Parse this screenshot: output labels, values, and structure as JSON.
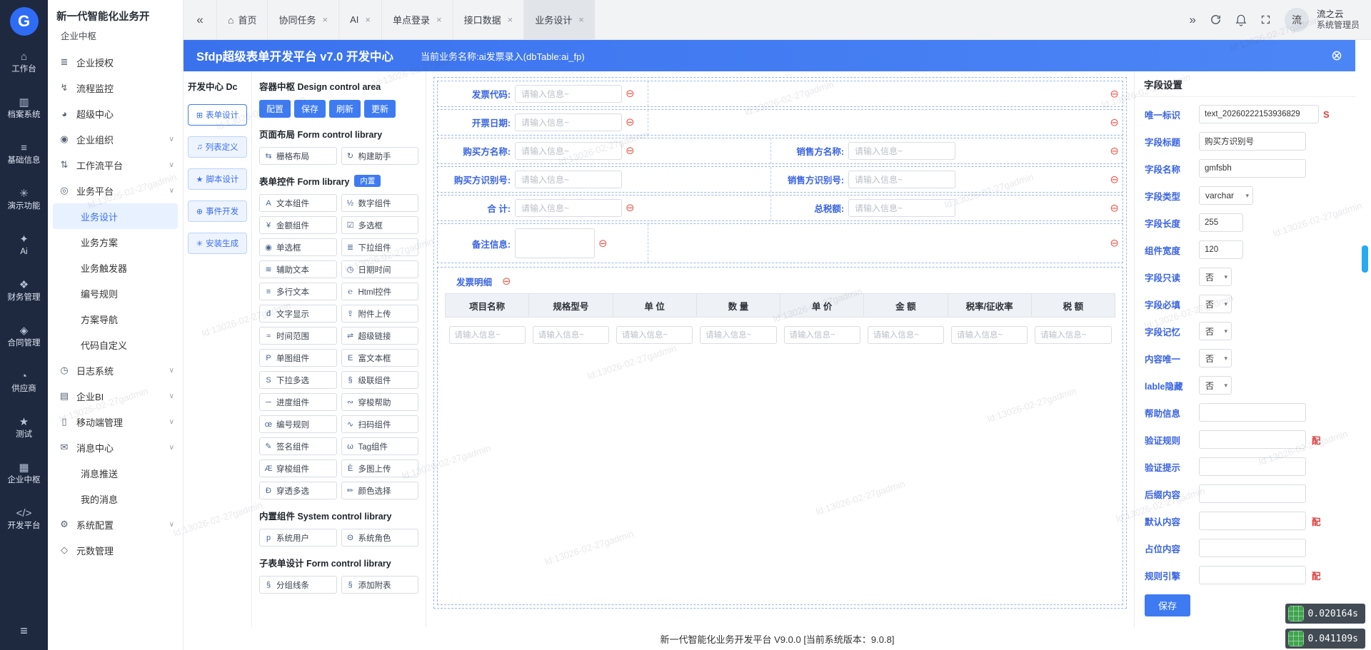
{
  "watermark_text": "ld:13026-02-27gadmin",
  "ui": {
    "chevron_down": "▾"
  },
  "rail": {
    "logo_text": "G",
    "items": [
      {
        "icon": "⌂",
        "label": "工作台"
      },
      {
        "icon": "▥",
        "label": "档案系统"
      },
      {
        "icon": "≡",
        "label": "基础信息"
      },
      {
        "icon": "✳",
        "label": "演示功能"
      },
      {
        "icon": "✦",
        "label": "Ai"
      },
      {
        "icon": "❖",
        "label": "财务管理"
      },
      {
        "icon": "◈",
        "label": "合同管理"
      },
      {
        "icon": "◔",
        "label": "供应商"
      },
      {
        "icon": "★",
        "label": "测试"
      },
      {
        "icon": "▦",
        "label": "企业中枢"
      },
      {
        "icon": "</>",
        "label": "开发平台"
      }
    ],
    "bottom_menu_icon": "≡"
  },
  "sidebar": {
    "title": "新一代智能化业务开",
    "subtitle": "企业中枢",
    "menu": [
      {
        "icon": "≣",
        "label": "企业授权"
      },
      {
        "icon": "↯",
        "label": "流程监控"
      },
      {
        "icon": "◕",
        "label": "超级中心"
      },
      {
        "icon": "◉",
        "label": "企业组织",
        "arrow": "∨"
      },
      {
        "icon": "⇅",
        "label": "工作流平台",
        "arrow": "∨"
      },
      {
        "icon": "◎",
        "label": "业务平台",
        "arrow": "∨",
        "children": [
          {
            "label": "业务设计"
          },
          {
            "label": "业务方案"
          },
          {
            "label": "业务触发器"
          },
          {
            "label": "编号规则"
          },
          {
            "label": "方案导航"
          },
          {
            "label": "代码自定义"
          }
        ]
      },
      {
        "icon": "◷",
        "label": "日志系统",
        "arrow": "∨"
      },
      {
        "icon": "▤",
        "label": "企业BI",
        "arrow": "∨"
      },
      {
        "icon": "▯",
        "label": "移动端管理",
        "arrow": "∨"
      },
      {
        "icon": "✉",
        "label": "消息中心",
        "arrow": "∨",
        "children": [
          {
            "label": "消息推送"
          },
          {
            "label": "我的消息"
          }
        ]
      },
      {
        "icon": "⚙",
        "label": "系统配置",
        "arrow": "∨"
      },
      {
        "icon": "◇",
        "label": "元数管理"
      }
    ]
  },
  "tabbar": {
    "collapse_icon": "«",
    "expand_icon": "»",
    "home_icon": "⌂",
    "close_icon": "×",
    "tabs": [
      {
        "label": "首页"
      },
      {
        "label": "协同任务"
      },
      {
        "label": "AI"
      },
      {
        "label": "单点登录"
      },
      {
        "label": "接口数据"
      },
      {
        "label": "业务设计"
      }
    ],
    "user": {
      "avatar_text": "流",
      "name": "流之云",
      "role": "系统管理员"
    }
  },
  "dev_window": {
    "title": "Sfdp超级表单开发平台 v7.0 开发中心",
    "business_label": "当前业务名称:ai发票录入(dbTable:ai_fp)",
    "close_icon": "⊗"
  },
  "dev_center": {
    "title": "开发中心 Dc",
    "tabs": [
      {
        "icon": "⊞",
        "label": "表单设计"
      },
      {
        "icon": "♫",
        "label": "列表定义"
      },
      {
        "icon": "★",
        "label": "脚本设计"
      },
      {
        "icon": "⊕",
        "label": "事件开发"
      },
      {
        "icon": "✳",
        "label": "安装生成"
      }
    ]
  },
  "control_area": {
    "title": "容器中枢 Design control area",
    "actions": [
      {
        "label": "配置"
      },
      {
        "label": "保存"
      },
      {
        "label": "刷新"
      },
      {
        "label": "更新"
      }
    ],
    "layout_section": {
      "title": "页面布局 Form control library",
      "items": [
        {
          "icon": "⇆",
          "label": "栅格布局"
        },
        {
          "icon": "↻",
          "label": "构建助手"
        }
      ]
    },
    "form_section": {
      "title": "表单控件 Form library",
      "badge": "内置",
      "items": [
        {
          "icon": "A",
          "label": "文本组件"
        },
        {
          "icon": "½",
          "label": "数字组件"
        },
        {
          "icon": "¥",
          "label": "金额组件"
        },
        {
          "icon": "☑",
          "label": "多选框"
        },
        {
          "icon": "◉",
          "label": "单选框"
        },
        {
          "icon": "≣",
          "label": "下拉组件"
        },
        {
          "icon": "≋",
          "label": "辅助文本"
        },
        {
          "icon": "◷",
          "label": "日期时间"
        },
        {
          "icon": "≡",
          "label": "多行文本"
        },
        {
          "icon": "℮",
          "label": "Html控件"
        },
        {
          "icon": "đ",
          "label": "文字显示"
        },
        {
          "icon": "⇪",
          "label": "附件上传"
        },
        {
          "icon": "≈",
          "label": "时间范围"
        },
        {
          "icon": "⇌",
          "label": "超级链接"
        },
        {
          "icon": "P",
          "label": "单图组件"
        },
        {
          "icon": "E",
          "label": "富文本框"
        },
        {
          "icon": "S",
          "label": "下拉多选"
        },
        {
          "icon": "§",
          "label": "级联组件"
        },
        {
          "icon": "─",
          "label": "进度组件"
        },
        {
          "icon": "∾",
          "label": "穿梭帮助"
        },
        {
          "icon": "œ",
          "label": "编号规则"
        },
        {
          "icon": "∿",
          "label": "扫码组件"
        },
        {
          "icon": "✎",
          "label": "签名组件"
        },
        {
          "icon": "ω",
          "label": "Tag组件"
        },
        {
          "icon": "Æ",
          "label": "穿梭组件"
        },
        {
          "icon": "È",
          "label": "多图上传"
        },
        {
          "icon": "Đ",
          "label": "穿透多选"
        },
        {
          "icon": "✏",
          "label": "颜色选择"
        }
      ]
    },
    "system_section": {
      "title": "内置组件 System control library",
      "items": [
        {
          "icon": "p",
          "label": "系统用户"
        },
        {
          "icon": "Θ",
          "label": "系统角色"
        }
      ]
    },
    "subform_section": {
      "title": "子表单设计 Form control library",
      "items": [
        {
          "icon": "§",
          "label": "分组线条"
        },
        {
          "icon": "§",
          "label": "添加附表"
        }
      ]
    }
  },
  "canvas": {
    "placeholder": "请输入信息~",
    "remove_icon": "⊖",
    "rows": [
      {
        "left": {
          "label": "发票代码:"
        }
      },
      {
        "left": {
          "label": "开票日期:"
        }
      },
      {
        "left": {
          "label": "购买方名称:"
        },
        "right": {
          "label": "销售方名称:"
        }
      },
      {
        "left": {
          "label": "购买方识别号:"
        },
        "right": {
          "label": "销售方识别号:"
        }
      },
      {
        "left": {
          "label": "合 计:"
        },
        "right": {
          "label": "总税额:"
        }
      },
      {
        "left": {
          "label": "备注信息:"
        }
      }
    ],
    "subtable": {
      "title": "发票明细",
      "columns": [
        "项目名称",
        "规格型号",
        "单 位",
        "数 量",
        "单 价",
        "金 额",
        "税率/征收率",
        "税 额"
      ]
    }
  },
  "field_settings": {
    "title": "字段设置",
    "rows": [
      {
        "label": "唯一标识",
        "value": "text_20260222153936829",
        "suffix": "S"
      },
      {
        "label": "字段标题",
        "value": "购买方识别号"
      },
      {
        "label": "字段名称",
        "value": "gmfsbh"
      },
      {
        "label": "字段类型",
        "value": "varchar"
      },
      {
        "label": "字段长度",
        "value": "255"
      },
      {
        "label": "组件宽度",
        "value": "120"
      },
      {
        "label": "字段只读",
        "value": "否"
      },
      {
        "label": "字段必填",
        "value": "否"
      },
      {
        "label": "字段记忆",
        "value": "否"
      },
      {
        "label": "内容唯一",
        "value": "否"
      },
      {
        "label": "lable隐藏",
        "value": "否"
      },
      {
        "label": "帮助信息",
        "value": ""
      },
      {
        "label": "验证规则",
        "value": "",
        "action": "配"
      },
      {
        "label": "验证提示",
        "value": ""
      },
      {
        "label": "后缀内容",
        "value": ""
      },
      {
        "label": "默认内容",
        "value": "",
        "action": "配"
      },
      {
        "label": "占位内容",
        "value": ""
      },
      {
        "label": "规则引擎",
        "value": "",
        "action": "配"
      }
    ],
    "save_label": "保存"
  },
  "footer": {
    "text": "新一代智能化业务开发平台 V9.0.0 [当前系统版本：9.0.8]"
  },
  "perf": {
    "badges": [
      {
        "time": "0.020164s"
      },
      {
        "time": "0.041109s"
      }
    ]
  }
}
